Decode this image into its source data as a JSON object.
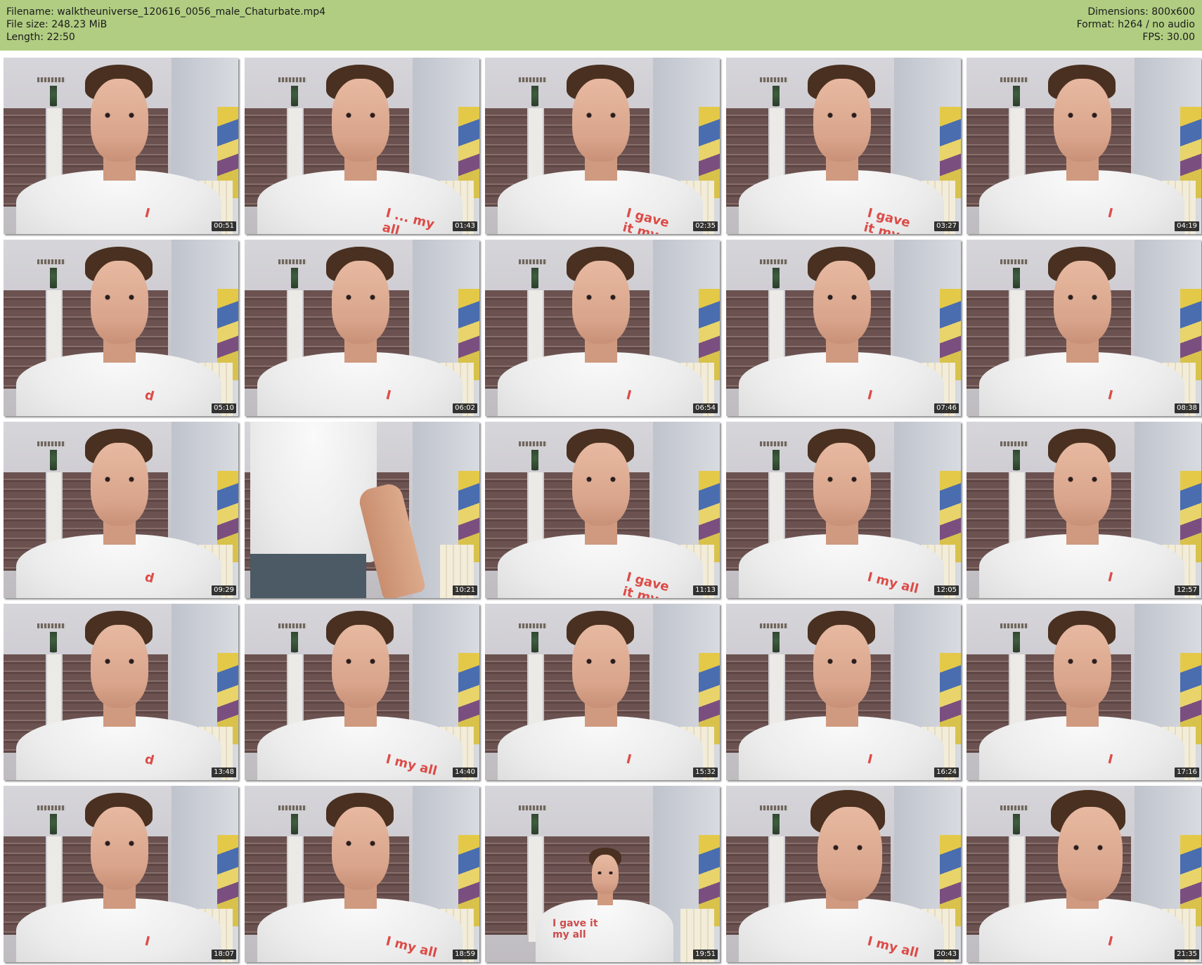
{
  "header": {
    "left": [
      "Filename: walktheuniverse_120616_0056_male_Chaturbate.mp4",
      "File size: 248.23 MiB",
      "Length: 22:50"
    ],
    "right": [
      "Dimensions: 800x600",
      "Format: h264 / no audio",
      "FPS: 30.00"
    ],
    "bar_color": "#b1cd82"
  },
  "thumbnails": [
    {
      "time": "00:51",
      "print": "I"
    },
    {
      "time": "01:43",
      "print": "I ... my all"
    },
    {
      "time": "02:35",
      "print": "I gave it my all"
    },
    {
      "time": "03:27",
      "print": "I gave it my all"
    },
    {
      "time": "04:19",
      "print": "I"
    },
    {
      "time": "05:10",
      "print": "d"
    },
    {
      "time": "06:02",
      "print": "I"
    },
    {
      "time": "06:54",
      "print": "I"
    },
    {
      "time": "07:46",
      "print": "I"
    },
    {
      "time": "08:38",
      "print": "I"
    },
    {
      "time": "09:29",
      "print": "d"
    },
    {
      "time": "10:21",
      "print": ""
    },
    {
      "time": "11:13",
      "print": "I gave it my all"
    },
    {
      "time": "12:05",
      "print": "I my all"
    },
    {
      "time": "12:57",
      "print": "I"
    },
    {
      "time": "13:48",
      "print": "d"
    },
    {
      "time": "14:40",
      "print": "I my all"
    },
    {
      "time": "15:32",
      "print": "I"
    },
    {
      "time": "16:24",
      "print": "I"
    },
    {
      "time": "17:16",
      "print": "I"
    },
    {
      "time": "18:07",
      "print": "I"
    },
    {
      "time": "18:59",
      "print": "I my all"
    },
    {
      "time": "19:51",
      "print": "I gave it my all"
    },
    {
      "time": "20:43",
      "print": "I my all"
    },
    {
      "time": "21:35",
      "print": "I"
    }
  ]
}
